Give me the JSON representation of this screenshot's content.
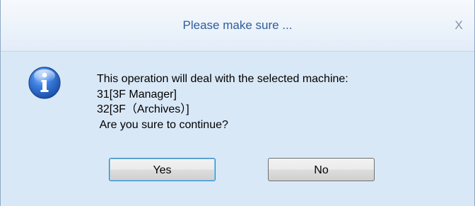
{
  "dialog": {
    "title": "Please make sure ...",
    "close_label": "X",
    "icon": "information-icon",
    "message_lines": [
      "This operation will deal with the selected machine:",
      "31[3F Manager]",
      "32[3F（Archives）]",
      " Are you sure to continue?"
    ],
    "buttons": {
      "yes_label": "Yes",
      "no_label": "No"
    }
  },
  "colors": {
    "body_background": "#d9e8f7",
    "title_text": "#2f5d9b",
    "icon_blue": "#2a63c7",
    "default_button_border": "#3c7fb1"
  }
}
